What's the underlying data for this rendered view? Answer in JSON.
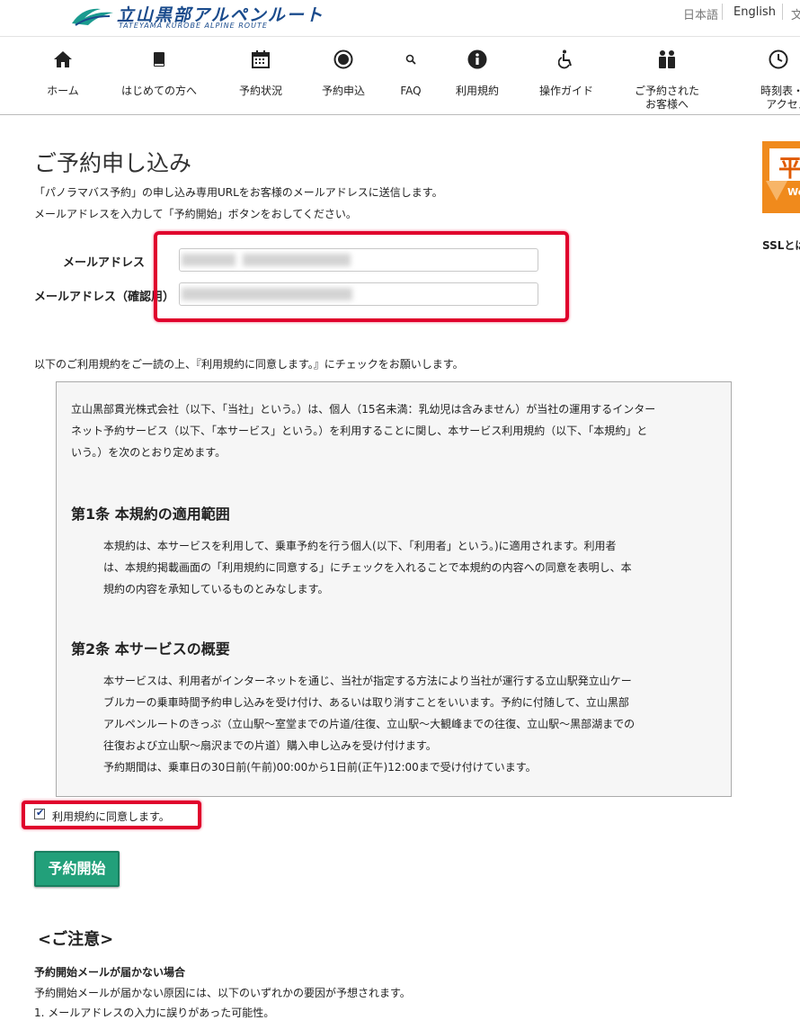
{
  "header": {
    "logo_main": "立山黒部アルペンルート",
    "logo_sub": "TATEYAMA KUROBE ALPINE ROUTE",
    "lang_ja": "日本語",
    "lang_en": "English",
    "lang_third": "文"
  },
  "nav": [
    {
      "label": "ホーム",
      "icon": "home-icon"
    },
    {
      "label": "はじめての方へ",
      "icon": "book-icon"
    },
    {
      "label": "予約状況",
      "icon": "calendar-icon"
    },
    {
      "label": "予約申込",
      "icon": "record-icon"
    },
    {
      "label": "FAQ",
      "icon": "search-icon"
    },
    {
      "label": "利用規約",
      "icon": "info-icon"
    },
    {
      "label": "操作ガイド",
      "icon": "wheelchair-icon"
    },
    {
      "label_line1": "ご予約された",
      "label_line2": "お客様へ",
      "icon": "users-icon"
    },
    {
      "label_line1": "時刻表・運",
      "label_line2": "アクセス",
      "icon": "clock-icon"
    }
  ],
  "main": {
    "title": "ご予約申し込み",
    "intro1": "「パノラマバス予約」の申し込み専用URLをお客様のメールアドレスに送信します。",
    "intro2": "メールアドレスを入力して「予約開始」ボタンをおしてください。",
    "email_label": "メールアドレス",
    "email_confirm_label": "メールアドレス（確認用）",
    "agree_intro": "以下のご利用規約をご一読の上、『利用規約に同意します。』にチェックをお願いします。"
  },
  "terms": {
    "p1_l1": "立山黒部貫光株式会社（以下、「当社」という。）は、個人（15名未満：乳幼児は含みません）が当社の運用するインター",
    "p1_l2": "ネット予約サービス（以下、「本サービス」という。）を利用することに関し、本サービス利用規約（以下、「本規約」と",
    "p1_l3": "いう。）を次のとおり定めます。",
    "h1": "第1条 本規約の適用範囲",
    "a1_l1": "本規約は、本サービスを利用して、乗車予約を行う個人(以下、「利用者」という。)に適用されます。利用者",
    "a1_l2": "は、本規約掲載画面の「利用規約に同意する」にチェックを入れることで本規約の内容への同意を表明し、本",
    "a1_l3": "規約の内容を承知しているものとみなします。",
    "h2": "第2条 本サービスの概要",
    "a2_l1": "本サービスは、利用者がインターネットを通じ、当社が指定する方法により当社が運行する立山駅発立山ケー",
    "a2_l2": "ブルカーの乗車時間予約申し込みを受け付け、あるいは取り消すことをいいます。予約に付随して、立山黒部",
    "a2_l3": "アルペンルートのきっぷ（立山駅～室堂までの片道/往復、立山駅～大観峰までの往復、立山駅～黒部湖までの",
    "a2_l4": "往復および立山駅～扇沢までの片道）購入申し込みを受け付けます。",
    "a2_l5": "予約期間は、乗車日の30日前(午前)00:00から1日前(正午)12:00まで受け付けています。"
  },
  "agree": {
    "label": "利用規約に同意します。",
    "checked": true
  },
  "start_button": "予約開始",
  "notice": {
    "heading": "<ご注意>",
    "sub": "予約開始メールが届かない場合",
    "line1": "予約開始メールが届かない原因には、以下のいずれかの要因が予想されます。",
    "line2": "1. メールアドレスの入力に誤りがあった可能性。"
  },
  "sidebar": {
    "banner_char": "平",
    "banner_text": "We",
    "ssl": "SSLとは"
  }
}
